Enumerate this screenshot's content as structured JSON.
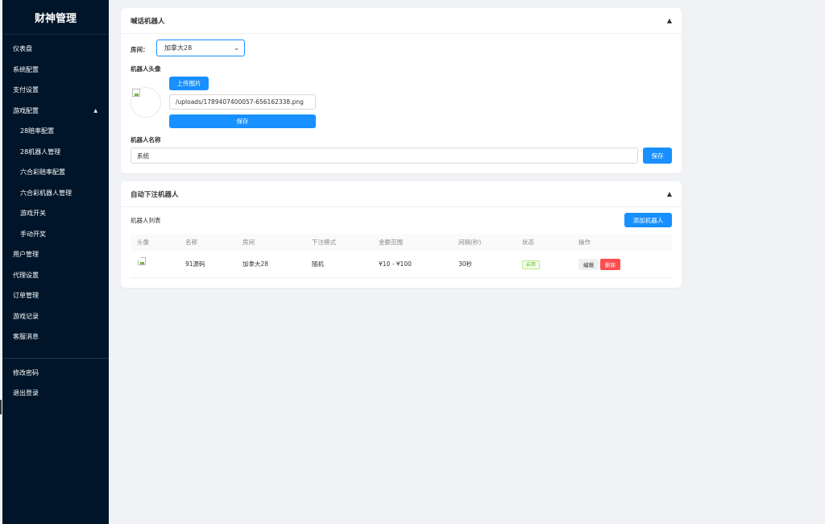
{
  "sidebar": {
    "title": "财神管理",
    "items": [
      {
        "label": "仪表盘"
      },
      {
        "label": "系统配置"
      },
      {
        "label": "支付设置"
      },
      {
        "label": "游戏配置"
      },
      {
        "label": "28赔率配置"
      },
      {
        "label": "28机器人管理"
      },
      {
        "label": "六合彩赔率配置"
      },
      {
        "label": "六合彩机器人管理"
      },
      {
        "label": "游戏开关"
      },
      {
        "label": "手动开奖"
      },
      {
        "label": "用户管理"
      },
      {
        "label": "代理设置"
      },
      {
        "label": "订单管理"
      },
      {
        "label": "游戏记录"
      },
      {
        "label": "客服消息"
      }
    ],
    "bottom_items": [
      {
        "label": "修改密码"
      },
      {
        "label": "退出登录"
      }
    ],
    "expand_icon": "▲"
  },
  "chat_robot": {
    "title": "喊话机器人",
    "collapse_icon": "▲",
    "room_label": "房间：",
    "room_value": "加拿大28",
    "avatar_label": "机器人头像",
    "upload_label": "上传图片",
    "avatar_path": "/uploads/1789407400057-656162338.png",
    "save_avatar_label": "保存",
    "name_label": "机器人名称",
    "name_value": "系统",
    "save_name_label": "保存"
  },
  "auto_bet": {
    "title": "自动下注机器人",
    "collapse_icon": "▲",
    "list_label": "机器人列表",
    "add_label": "添加机器人",
    "columns": [
      "头像",
      "名称",
      "房间",
      "下注模式",
      "金额范围",
      "间隔(秒)",
      "状态",
      "操作"
    ],
    "rows": [
      {
        "name": "91源码",
        "room": "加拿大28",
        "mode": "随机",
        "amount": "¥10 - ¥100",
        "interval": "30秒",
        "status": "启用",
        "edit": "编辑",
        "delete": "删除"
      }
    ]
  },
  "colors": {
    "sidebar_bg": "#001529",
    "primary": "#1890ff",
    "danger": "#ff4d4f",
    "success": "#52c41a"
  }
}
